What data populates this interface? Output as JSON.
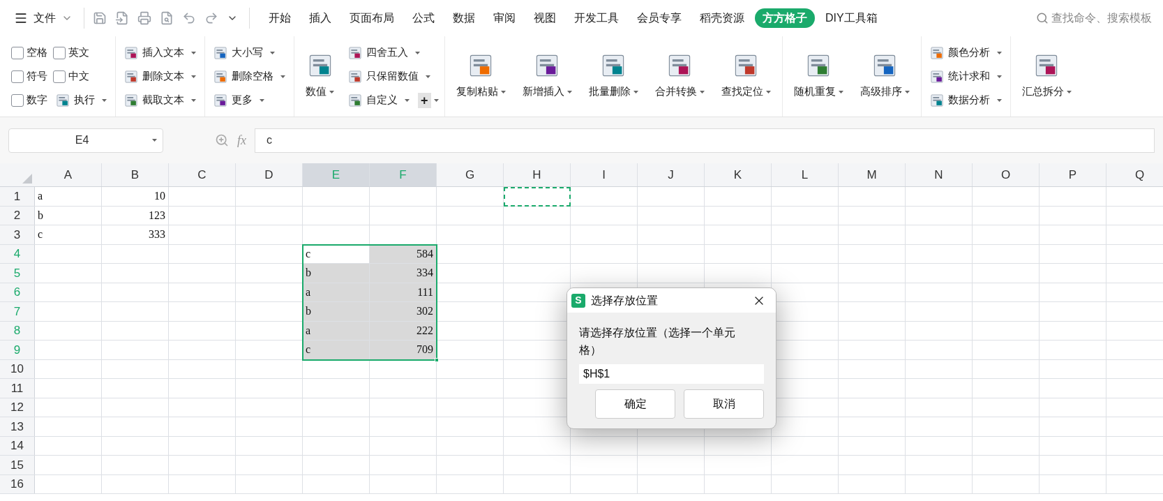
{
  "menu_bar": {
    "file_label": "文件",
    "tabs": [
      {
        "label": "开始",
        "selected": false
      },
      {
        "label": "插入",
        "selected": false
      },
      {
        "label": "页面布局",
        "selected": false
      },
      {
        "label": "公式",
        "selected": false
      },
      {
        "label": "数据",
        "selected": false
      },
      {
        "label": "审阅",
        "selected": false
      },
      {
        "label": "视图",
        "selected": false
      },
      {
        "label": "开发工具",
        "selected": false
      },
      {
        "label": "会员专享",
        "selected": false
      },
      {
        "label": "稻壳资源",
        "selected": false
      },
      {
        "label": "方方格子",
        "selected": true
      },
      {
        "label": "DIY工具箱",
        "selected": false
      }
    ],
    "search": {
      "placeholder": "查找命令、搜索模板"
    }
  },
  "ribbon": {
    "groups": [
      {
        "columns": [
          [
            [
              {
                "kind": "checkbox",
                "label": "空格",
                "checked": false
              },
              {
                "kind": "checkbox",
                "label": "英文",
                "checked": false
              }
            ],
            [
              {
                "kind": "checkbox",
                "label": "符号",
                "checked": false
              },
              {
                "kind": "checkbox",
                "label": "中文",
                "checked": false
              }
            ],
            [
              {
                "kind": "checkbox",
                "label": "数字",
                "checked": false
              },
              {
                "kind": "tool",
                "label": "执行",
                "dropdown": true
              }
            ]
          ]
        ]
      },
      {
        "columns": [
          [
            [
              {
                "kind": "tool",
                "label": "插入文本",
                "dropdown": true
              }
            ],
            [
              {
                "kind": "tool",
                "label": "删除文本",
                "dropdown": true
              }
            ],
            [
              {
                "kind": "tool",
                "label": "截取文本",
                "dropdown": true
              }
            ]
          ]
        ]
      },
      {
        "columns": [
          [
            [
              {
                "kind": "tool",
                "label": "大小写",
                "dropdown": true
              }
            ],
            [
              {
                "kind": "tool",
                "label": "删除空格",
                "dropdown": true
              }
            ],
            [
              {
                "kind": "tool",
                "label": "更多",
                "dropdown": true
              }
            ]
          ]
        ]
      },
      {
        "columns": [
          [
            [
              {
                "kind": "large",
                "label": "数值",
                "dropdown": true
              }
            ]
          ],
          [
            [
              {
                "kind": "tool",
                "label": "四舍五入",
                "dropdown": true
              }
            ],
            [
              {
                "kind": "tool",
                "label": "只保留数值",
                "dropdown": true
              }
            ],
            [
              {
                "kind": "tool",
                "label": "自定义",
                "dropdown": true
              },
              {
                "kind": "plus",
                "label": "+",
                "dropdown": true
              }
            ]
          ]
        ]
      },
      {
        "columns": [
          [
            [
              {
                "kind": "large",
                "label": "复制粘贴",
                "dropdown": true
              }
            ]
          ],
          [
            [
              {
                "kind": "large",
                "label": "新增插入",
                "dropdown": true
              }
            ]
          ],
          [
            [
              {
                "kind": "large",
                "label": "批量删除",
                "dropdown": true
              }
            ]
          ],
          [
            [
              {
                "kind": "large",
                "label": "合并转换",
                "dropdown": true
              }
            ]
          ],
          [
            [
              {
                "kind": "large",
                "label": "查找定位",
                "dropdown": true
              }
            ]
          ]
        ]
      },
      {
        "columns": [
          [
            [
              {
                "kind": "large",
                "label": "随机重复",
                "dropdown": true
              }
            ]
          ],
          [
            [
              {
                "kind": "large",
                "label": "高级排序",
                "dropdown": true
              }
            ]
          ]
        ]
      },
      {
        "columns": [
          [
            [
              {
                "kind": "tool",
                "label": "颜色分析",
                "dropdown": true
              }
            ],
            [
              {
                "kind": "tool",
                "label": "统计求和",
                "dropdown": true
              }
            ],
            [
              {
                "kind": "tool",
                "label": "数据分析",
                "dropdown": true
              }
            ]
          ]
        ]
      },
      {
        "columns": [
          [
            [
              {
                "kind": "large",
                "label": "汇总拆分",
                "dropdown": true
              }
            ]
          ]
        ]
      }
    ]
  },
  "formula_bar": {
    "name_box": "E4",
    "fx": "fx",
    "formula": "c"
  },
  "sheet": {
    "columns": [
      {
        "label": "A",
        "selected": false
      },
      {
        "label": "B",
        "selected": false
      },
      {
        "label": "C",
        "selected": false
      },
      {
        "label": "D",
        "selected": false
      },
      {
        "label": "E",
        "selected": true
      },
      {
        "label": "F",
        "selected": true
      },
      {
        "label": "G",
        "selected": false
      },
      {
        "label": "H",
        "selected": false
      },
      {
        "label": "I",
        "selected": false
      },
      {
        "label": "J",
        "selected": false
      },
      {
        "label": "K",
        "selected": false
      },
      {
        "label": "L",
        "selected": false
      },
      {
        "label": "M",
        "selected": false
      },
      {
        "label": "N",
        "selected": false
      },
      {
        "label": "O",
        "selected": false
      },
      {
        "label": "P",
        "selected": false
      },
      {
        "label": "Q",
        "selected": false
      }
    ],
    "rows": [
      {
        "header": "1",
        "selected": false,
        "cells": [
          {
            "text": "a",
            "kind": "text",
            "selected": false
          },
          {
            "text": "10",
            "kind": "number",
            "selected": false
          },
          {},
          {},
          {},
          {},
          {},
          {
            "marquee": true
          }
        ]
      },
      {
        "header": "2",
        "selected": false,
        "cells": [
          {
            "text": "b",
            "kind": "text",
            "selected": false
          },
          {
            "text": "123",
            "kind": "number",
            "selected": false
          }
        ]
      },
      {
        "header": "3",
        "selected": false,
        "cells": [
          {
            "text": "c",
            "kind": "text",
            "selected": false
          },
          {
            "text": "333",
            "kind": "number",
            "selected": false
          }
        ]
      },
      {
        "header": "4",
        "selected": true,
        "cells": [
          {},
          {},
          {},
          {},
          {
            "text": "c",
            "kind": "text",
            "selected": true,
            "active": true
          },
          {
            "text": "584",
            "kind": "number",
            "selected": true
          }
        ]
      },
      {
        "header": "5",
        "selected": true,
        "cells": [
          {},
          {},
          {},
          {},
          {
            "text": "b",
            "kind": "text",
            "selected": true
          },
          {
            "text": "334",
            "kind": "number",
            "selected": true
          }
        ]
      },
      {
        "header": "6",
        "selected": true,
        "cells": [
          {},
          {},
          {},
          {},
          {
            "text": "a",
            "kind": "text",
            "selected": true
          },
          {
            "text": "111",
            "kind": "number",
            "selected": true
          }
        ]
      },
      {
        "header": "7",
        "selected": true,
        "cells": [
          {},
          {},
          {},
          {},
          {
            "text": "b",
            "kind": "text",
            "selected": true
          },
          {
            "text": "302",
            "kind": "number",
            "selected": true
          }
        ]
      },
      {
        "header": "8",
        "selected": true,
        "cells": [
          {},
          {},
          {},
          {},
          {
            "text": "a",
            "kind": "text",
            "selected": true
          },
          {
            "text": "222",
            "kind": "number",
            "selected": true
          }
        ]
      },
      {
        "header": "9",
        "selected": true,
        "cells": [
          {},
          {},
          {},
          {},
          {
            "text": "c",
            "kind": "text",
            "selected": true
          },
          {
            "text": "709",
            "kind": "number",
            "selected": true
          }
        ]
      },
      {
        "header": "10",
        "selected": false
      },
      {
        "header": "11",
        "selected": false
      },
      {
        "header": "12",
        "selected": false
      },
      {
        "header": "13",
        "selected": false
      },
      {
        "header": "14",
        "selected": false
      },
      {
        "header": "15",
        "selected": false
      },
      {
        "header": "16",
        "selected": false
      }
    ]
  },
  "dialog": {
    "logo_letter": "S",
    "title": "选择存放位置",
    "prompt": "请选择存放位置（选择一个单元格）",
    "value": "$H$1",
    "buttons": [
      "确定",
      "取消"
    ]
  }
}
